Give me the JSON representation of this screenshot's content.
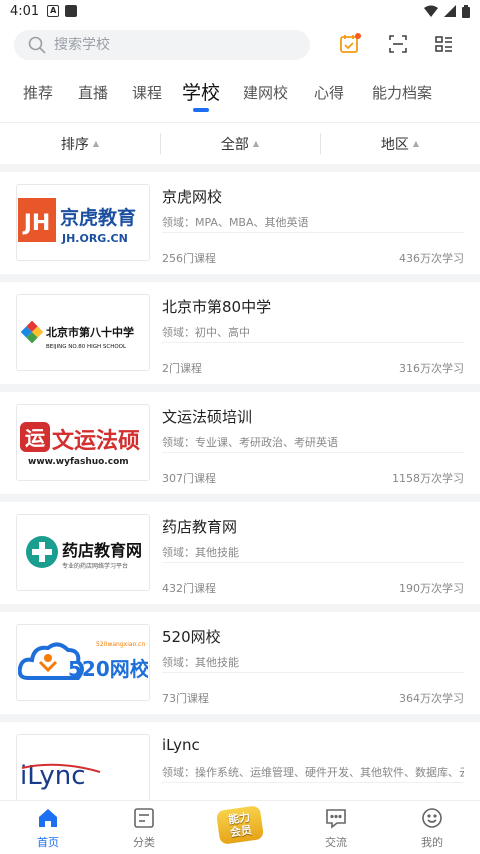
{
  "status_bar": {
    "time": "4:01",
    "notif_icon": "A"
  },
  "search": {
    "placeholder": "搜索学校"
  },
  "header_icons": [
    "calendar-icon",
    "scan-icon",
    "list-icon"
  ],
  "tabs": [
    {
      "label": "推荐"
    },
    {
      "label": "直播"
    },
    {
      "label": "课程"
    },
    {
      "label": "学校",
      "active": true
    },
    {
      "label": "建网校"
    },
    {
      "label": "心得"
    },
    {
      "label": "能力档案"
    }
  ],
  "filters": [
    {
      "label": "排序"
    },
    {
      "label": "全部"
    },
    {
      "label": "地区"
    }
  ],
  "schools": [
    {
      "name": "京虎网校",
      "field": "领域：MPA、MBA、其他英语",
      "courses": "256门课程",
      "views": "436万次学习",
      "logo_main": "京虎教育",
      "logo_badge": "JH",
      "logo_sub": "JH.ORG.CN"
    },
    {
      "name": "北京市第80中学",
      "field": "领域：初中、高中",
      "courses": "2门课程",
      "views": "316万次学习",
      "logo_main": "北京市第八十中学",
      "logo_sub": "BEIJING NO.80 HIGH SCHOOL"
    },
    {
      "name": "文运法硕培训",
      "field": "领域：专业课、考研政治、考研英语",
      "courses": "307门课程",
      "views": "1158万次学习",
      "logo_main": "文运法硕",
      "logo_badge": "运",
      "logo_sub": "www.wyfashuo.com"
    },
    {
      "name": "药店教育网",
      "field": "领域：其他技能",
      "courses": "432门课程",
      "views": "190万次学习",
      "logo_main": "药店教育网",
      "logo_sub": "专业的药店网络学习平台"
    },
    {
      "name": "520网校",
      "field": "领域：其他技能",
      "courses": "73门课程",
      "views": "364万次学习",
      "logo_main": "520网校",
      "logo_sub": "520wangxiao.cn"
    },
    {
      "name": "iLync",
      "field": "领域：操作系统、运维管理、硬件开发、其他软件、数据库、云...",
      "courses": "",
      "views": "",
      "logo_main": "iLync"
    }
  ],
  "bottom_nav": [
    {
      "label": "首页",
      "active": true
    },
    {
      "label": "分类"
    },
    {
      "label": "",
      "vip": [
        "能力",
        "会员"
      ]
    },
    {
      "label": "交流"
    },
    {
      "label": "我的"
    }
  ],
  "colors": {
    "accent": "#1d6ff2",
    "badge": "#ff5722",
    "calendar": "#f39c12"
  }
}
